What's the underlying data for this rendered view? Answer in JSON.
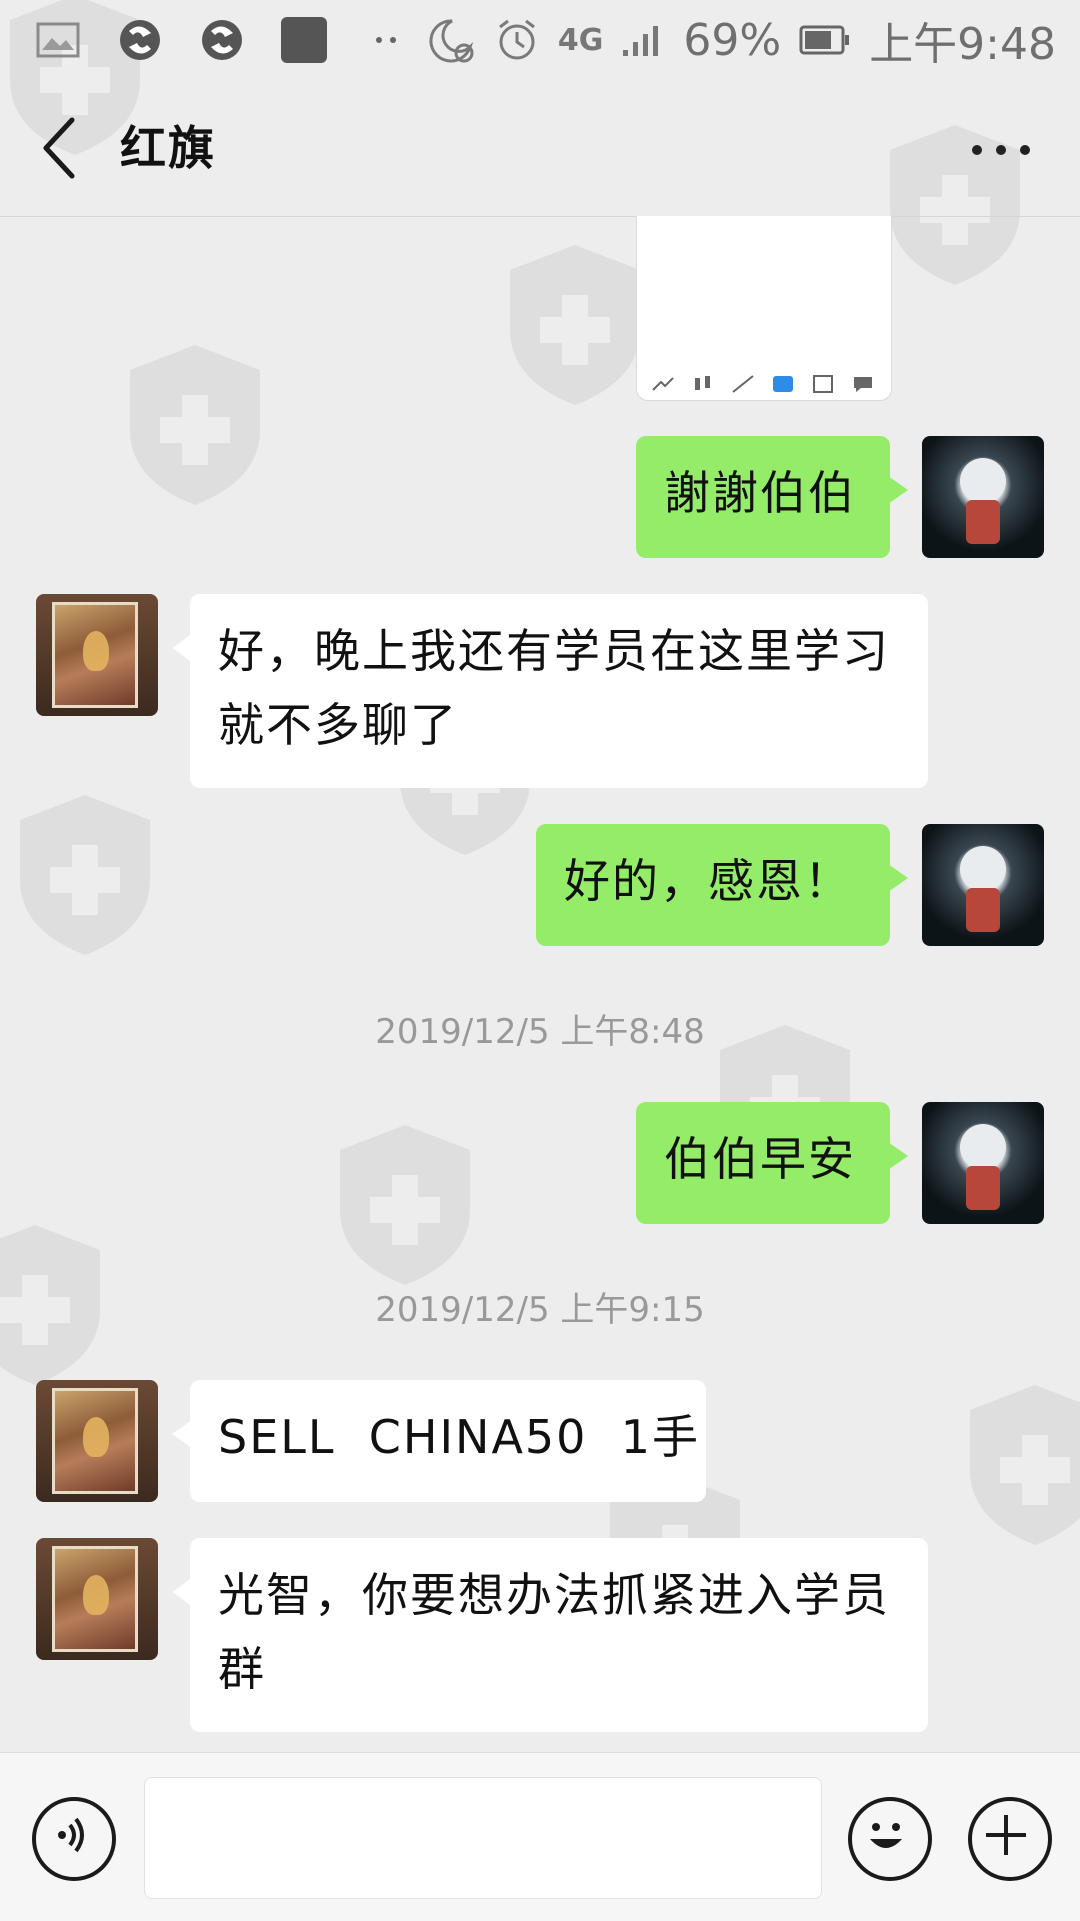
{
  "status_bar": {
    "network": "4G",
    "battery": "69%",
    "time": "上午9:48"
  },
  "header": {
    "title": "红旗"
  },
  "messages": [
    {
      "side": "me",
      "text": "謝謝伯伯"
    },
    {
      "side": "them",
      "text": "好，晚上我还有学员在这里学习就不多聊了"
    },
    {
      "side": "me",
      "text": "好的，感恩！"
    },
    {
      "type": "time",
      "text": "2019/12/5 上午8:48"
    },
    {
      "side": "me",
      "text": "伯伯早安"
    },
    {
      "type": "time",
      "text": "2019/12/5 上午9:15"
    },
    {
      "side": "them",
      "text": "SELL  CHINA50  1手"
    },
    {
      "side": "them",
      "text": "光智，你要想办法抓紧进入学员群"
    }
  ],
  "input": {
    "value": ""
  },
  "colors": {
    "bubble_me": "#95ec69",
    "bubble_them": "#ffffff",
    "background": "#ededed"
  },
  "icons": [
    "voice-icon",
    "emoji-icon",
    "plus-icon",
    "back-icon",
    "more-icon"
  ]
}
